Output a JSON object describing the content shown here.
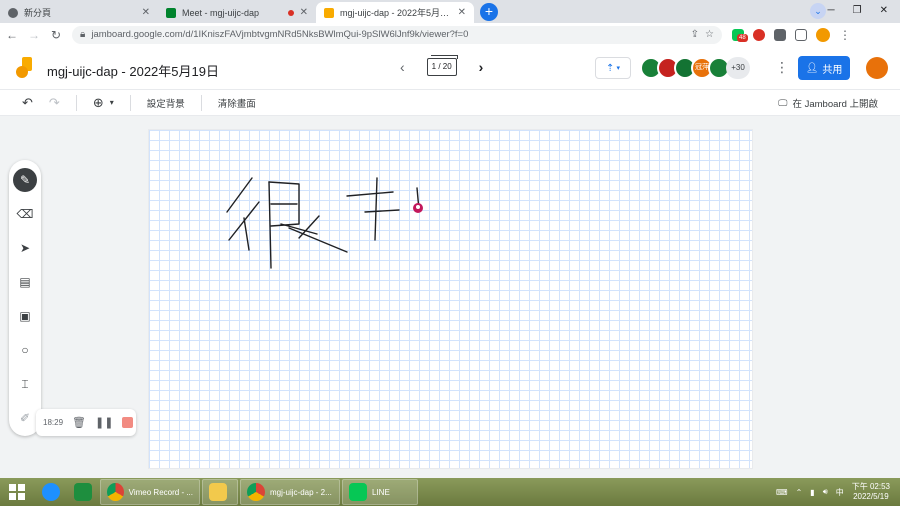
{
  "browser": {
    "tabs": [
      {
        "title": "新分頁",
        "icon": "chrome-newtab-icon"
      },
      {
        "title": "Meet - mgj-uijc-dap",
        "icon": "google-meet-icon",
        "recording": true
      },
      {
        "title": "mgj-uijc-dap - 2022年5月19日",
        "icon": "jamboard-icon",
        "active": true
      }
    ],
    "url": "jamboard.google.com/d/1IKniszFAVjmbtvgmNRd5NksBWlmQui-9pSlW6lJnf9k/viewer?f=0",
    "extension_badge": "48"
  },
  "app": {
    "title": "mgj-uijc-dap - 2022年5月19日",
    "frame_indicator": "1 / 20",
    "share_label": "共用",
    "participants": [
      {
        "initial": "",
        "color": "#188038"
      },
      {
        "initial": "",
        "color": "#c5221f"
      },
      {
        "initial": "",
        "color": "#137333"
      },
      {
        "initial": "冠萍",
        "color": "#e8710a"
      },
      {
        "initial": "",
        "color": "#188038"
      }
    ],
    "more_participants": "+30"
  },
  "toolbar": {
    "set_background": "設定背景",
    "clear_frame": "清除畫面",
    "open_in_jamboard": "在 Jamboard 上開啟"
  },
  "recorder": {
    "time": "18:29"
  },
  "taskbar": {
    "items": [
      {
        "label": "Vimeo Record - ...",
        "icon": "chrome-icon"
      },
      {
        "label": "",
        "icon": "file-explorer-icon"
      },
      {
        "label": "mgj-uijc-dap - 2...",
        "icon": "chrome-icon"
      },
      {
        "label": "LINE",
        "icon": "line-icon"
      }
    ],
    "clock_time": "下午 02:53",
    "clock_date": "2022/5/19",
    "ime": "中"
  },
  "colors": {
    "accent": "#1a73e8",
    "grid": "#d2e3fc",
    "ink": "#202124",
    "cursor_pin": "#c2185b"
  }
}
